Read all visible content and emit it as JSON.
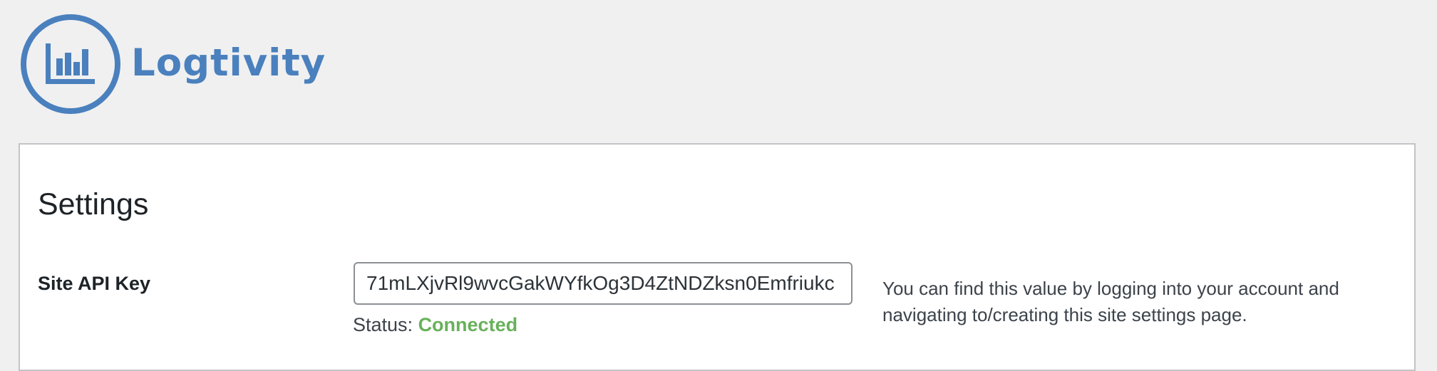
{
  "brand": {
    "name": "Logtivity",
    "logo_icon": "bar-chart-circle-icon",
    "color": "#4a80bd"
  },
  "settings": {
    "title": "Settings",
    "api_key": {
      "label": "Site API Key",
      "value": "71mLXjvRl9wvcGakWYfkOg3D4ZtNDZksn0Emfriukc",
      "status_label": "Status:",
      "status_value": "Connected",
      "status_color": "#68b15b",
      "help": "You can find this value by logging into your account and navigating to/creating this site settings page."
    }
  }
}
